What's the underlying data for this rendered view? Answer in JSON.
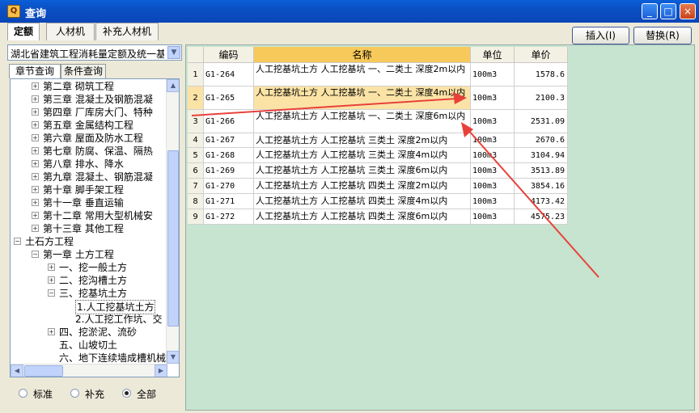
{
  "window": {
    "title": "查询",
    "minimize": "_",
    "maximize": "□",
    "close": "×"
  },
  "top_tabs": [
    "定额",
    "人材机",
    "补充人材机"
  ],
  "buttons": {
    "insert": "插入(I)",
    "replace": "替换(R)"
  },
  "left": {
    "dropdown_value": "湖北省建筑工程消耗量定额及统一基",
    "sub_tabs": [
      "章节查询",
      "条件查询"
    ],
    "tree": [
      {
        "label": "第二章  砌筑工程",
        "level": 1,
        "expander": "+"
      },
      {
        "label": "第三章  混凝土及钢筋混凝",
        "level": 1,
        "expander": "+"
      },
      {
        "label": "第四章  厂库房大门、特种",
        "level": 1,
        "expander": "+"
      },
      {
        "label": "第五章  金属结构工程",
        "level": 1,
        "expander": "+"
      },
      {
        "label": "第六章  屋面及防水工程",
        "level": 1,
        "expander": "+"
      },
      {
        "label": "第七章  防腐、保温、隔热",
        "level": 1,
        "expander": "+"
      },
      {
        "label": "第八章  排水、降水",
        "level": 1,
        "expander": "+"
      },
      {
        "label": "第九章  混凝土、钢筋混凝",
        "level": 1,
        "expander": "+"
      },
      {
        "label": "第十章  脚手架工程",
        "level": 1,
        "expander": "+"
      },
      {
        "label": "第十一章  垂直运输",
        "level": 1,
        "expander": "+"
      },
      {
        "label": "第十二章  常用大型机械安",
        "level": 1,
        "expander": "+"
      },
      {
        "label": "第十三章  其他工程",
        "level": 1,
        "expander": "+"
      },
      {
        "label": "土石方工程",
        "level": 0,
        "expander": "−"
      },
      {
        "label": "第一章  土方工程",
        "level": 1,
        "expander": "−"
      },
      {
        "label": "一、挖一般土方",
        "level": 2,
        "expander": "+"
      },
      {
        "label": "二、挖沟槽土方",
        "level": 2,
        "expander": "+"
      },
      {
        "label": "三、挖基坑土方",
        "level": 2,
        "expander": "−"
      },
      {
        "label": "1.人工挖基坑土方",
        "level": 3,
        "expander": ""
      },
      {
        "label": "2.人工挖工作坑、交",
        "level": 3,
        "expander": ""
      },
      {
        "label": "四、挖淤泥、流砂",
        "level": 2,
        "expander": "+"
      },
      {
        "label": "五、山坡切土",
        "level": 2,
        "expander": ""
      },
      {
        "label": "六、地下连续墙成槽机械",
        "level": 2,
        "expander": ""
      }
    ],
    "radios": [
      {
        "label": "标准",
        "checked": false
      },
      {
        "label": "补充",
        "checked": false
      },
      {
        "label": "全部",
        "checked": true
      }
    ]
  },
  "grid": {
    "headers": [
      "",
      "编码",
      "名称",
      "单位",
      "单价"
    ],
    "rows": [
      {
        "n": "1",
        "code": "G1-264",
        "name": "人工挖基坑土方 人工挖基坑 一、二类土 深度2m以内",
        "unit": "100m3",
        "price": "1578.6"
      },
      {
        "n": "2",
        "code": "G1-265",
        "name": "人工挖基坑土方 人工挖基坑 一、二类土 深度4m以内",
        "unit": "100m3",
        "price": "2100.3"
      },
      {
        "n": "3",
        "code": "G1-266",
        "name": "人工挖基坑土方 人工挖基坑 一、二类土 深度6m以内",
        "unit": "100m3",
        "price": "2531.09"
      },
      {
        "n": "4",
        "code": "G1-267",
        "name": "人工挖基坑土方 人工挖基坑 三类土 深度2m以内",
        "unit": "100m3",
        "price": "2670.6"
      },
      {
        "n": "5",
        "code": "G1-268",
        "name": "人工挖基坑土方 人工挖基坑 三类土 深度4m以内",
        "unit": "100m3",
        "price": "3104.94"
      },
      {
        "n": "6",
        "code": "G1-269",
        "name": "人工挖基坑土方 人工挖基坑 三类土 深度6m以内",
        "unit": "100m3",
        "price": "3513.89"
      },
      {
        "n": "7",
        "code": "G1-270",
        "name": "人工挖基坑土方 人工挖基坑 四类土 深度2m以内",
        "unit": "100m3",
        "price": "3854.16"
      },
      {
        "n": "8",
        "code": "G1-271",
        "name": "人工挖基坑土方 人工挖基坑 四类土 深度4m以内",
        "unit": "100m3",
        "price": "4173.42"
      },
      {
        "n": "9",
        "code": "G1-272",
        "name": "人工挖基坑土方 人工挖基坑 四类土 深度6m以内",
        "unit": "100m3",
        "price": "4575.23"
      }
    ],
    "selected_row": 2
  },
  "colors": {
    "grid_bg": "#c6e4cf",
    "header_highlight": "#f7c95a",
    "annotation_arrow": "#e8413a"
  }
}
